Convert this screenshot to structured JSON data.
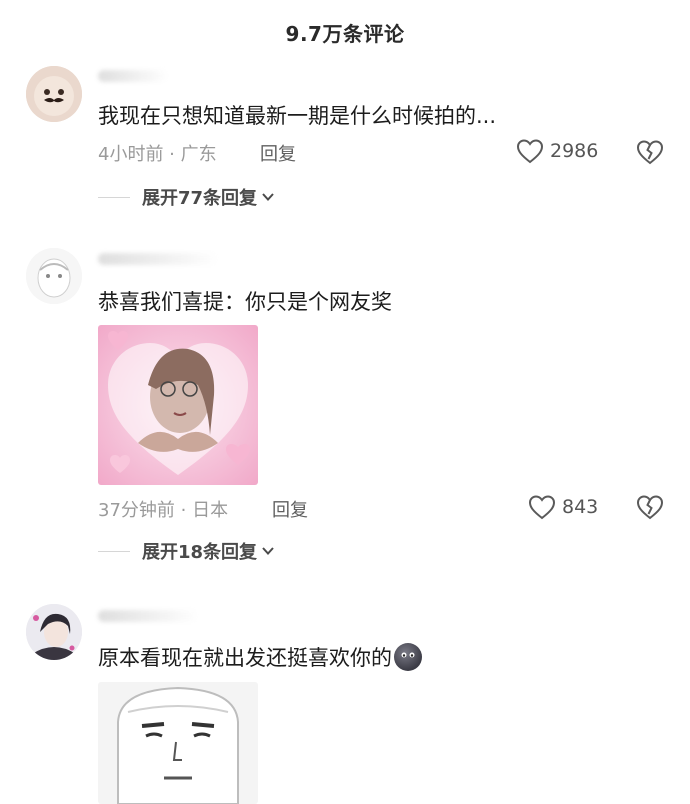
{
  "header": {
    "title": "9.7万条评论"
  },
  "comments": [
    {
      "text": "我现在只想知道最新一期是什么时候拍的...",
      "meta": "4小时前 · 广东",
      "reply_label": "回复",
      "likes": "2986",
      "expand_label": "展开77条回复"
    },
    {
      "text": "恭喜我们喜提：你只是个网友奖",
      "meta": "37分钟前 · 日本",
      "reply_label": "回复",
      "likes": "843",
      "expand_label": "展开18条回复"
    },
    {
      "text": "原本看现在就出发还挺喜欢你的"
    }
  ],
  "icons": {
    "like": "heart-outline-icon",
    "dislike": "broken-heart-icon",
    "expand": "chevron-down-icon"
  },
  "colors": {
    "meta": "#9a9a9a",
    "text": "#1c1c1c",
    "sticker_pink": "#f5b8d0"
  }
}
